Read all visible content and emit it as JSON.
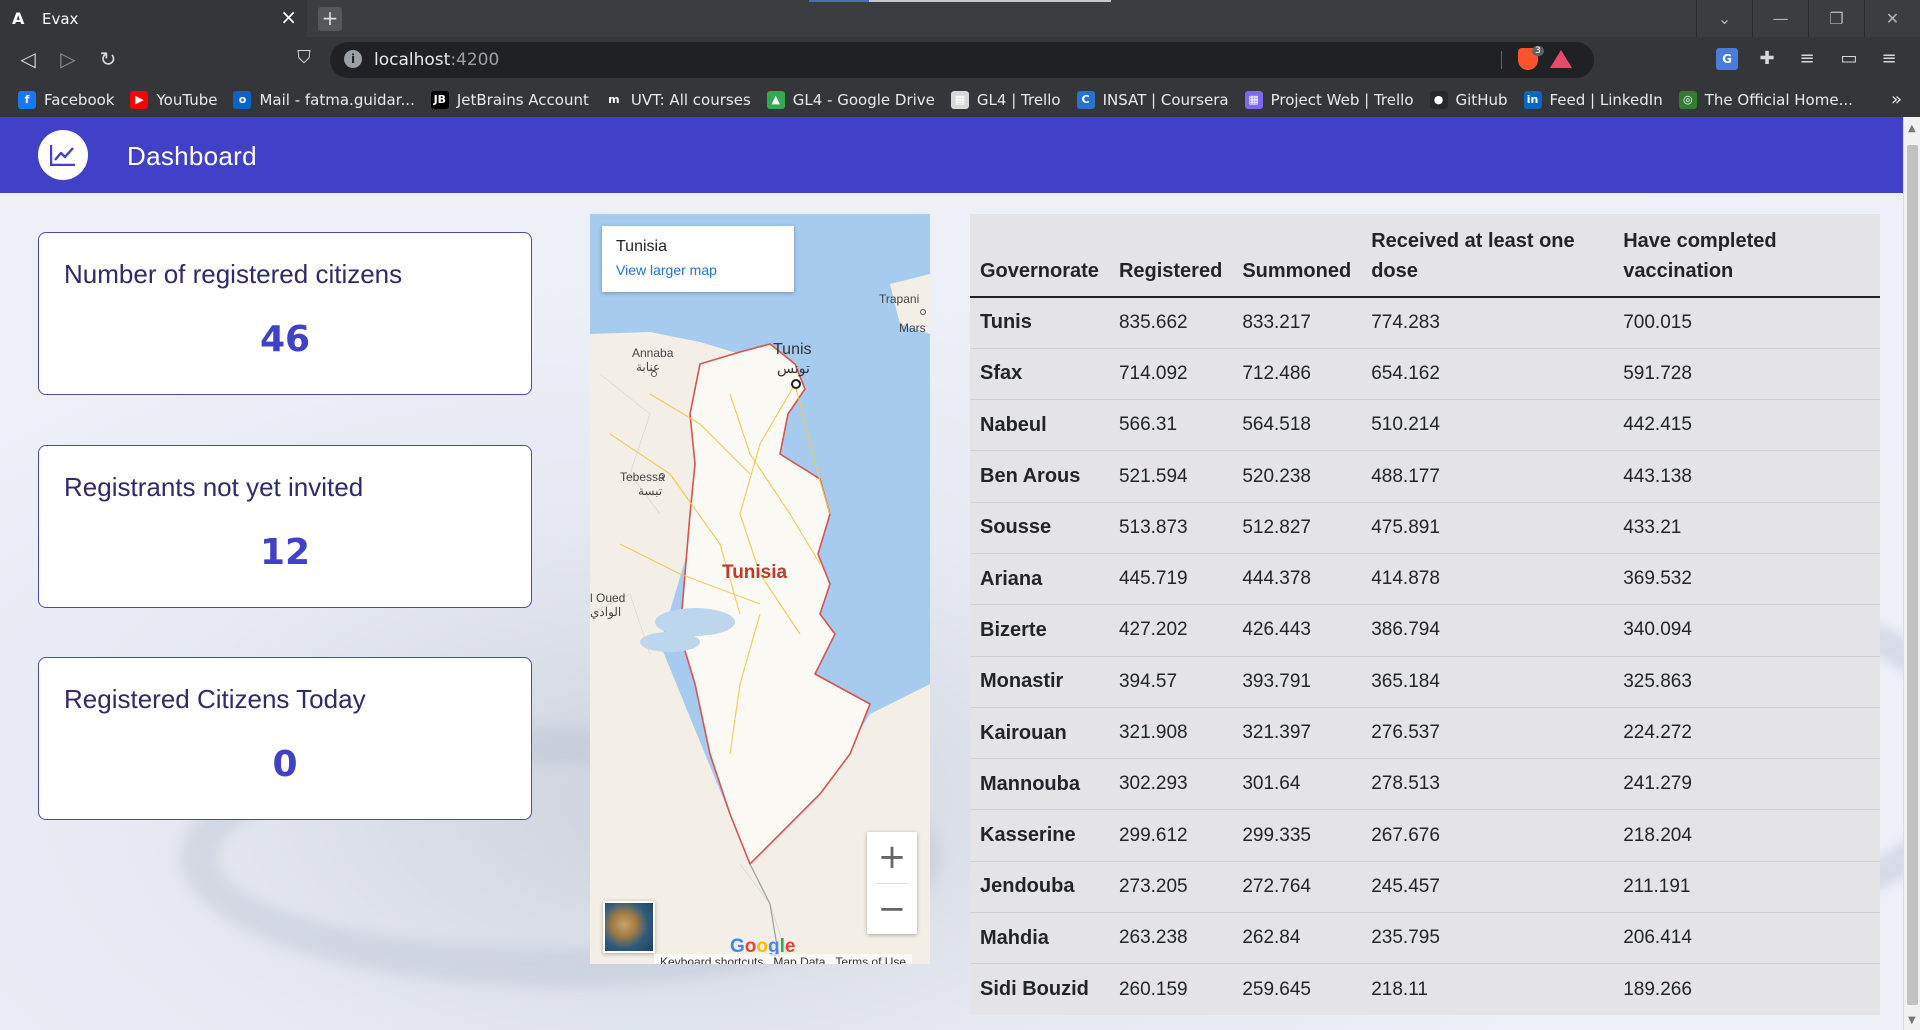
{
  "browser": {
    "tab_title": "Evax",
    "tab_favicon": "A",
    "new_tab": "+",
    "url_host": "localhost",
    "url_port": ":4200",
    "brave_badge": "3",
    "bookmarks": [
      {
        "label": "Facebook",
        "icon": "facebook-icon",
        "color": "#1877f2",
        "glyph": "f"
      },
      {
        "label": "YouTube",
        "icon": "youtube-icon",
        "color": "#ff0000",
        "glyph": "▶"
      },
      {
        "label": "Mail - fatma.guidar...",
        "icon": "outlook-icon",
        "color": "#0a64c8",
        "glyph": "o"
      },
      {
        "label": "JetBrains Account",
        "icon": "jetbrains-icon",
        "color": "#000000",
        "glyph": "JB"
      },
      {
        "label": "UVT: All courses",
        "icon": "moodle-icon",
        "color": "#35363a",
        "glyph": "m"
      },
      {
        "label": "GL4 - Google Drive",
        "icon": "google-drive-icon",
        "color": "#34a853",
        "glyph": "▲"
      },
      {
        "label": "GL4 | Trello",
        "icon": "trello-icon",
        "color": "#d8d8d8",
        "glyph": "▦"
      },
      {
        "label": "INSAT | Coursera",
        "icon": "coursera-icon",
        "color": "#2a73cc",
        "glyph": "C"
      },
      {
        "label": "Project Web | Trello",
        "icon": "trello-icon",
        "color": "#7b68ee",
        "glyph": "▦"
      },
      {
        "label": "GitHub",
        "icon": "github-icon",
        "color": "#24292e",
        "glyph": "●"
      },
      {
        "label": "Feed | LinkedIn",
        "icon": "linkedin-icon",
        "color": "#0a66c2",
        "glyph": "in"
      },
      {
        "label": "The Official Home...",
        "icon": "globe-icon",
        "color": "#2e7d32",
        "glyph": "◎"
      }
    ],
    "bookmarks_more": "»"
  },
  "app": {
    "title": "Dashboard",
    "accent": "#4140c9"
  },
  "stats": [
    {
      "label": "Number of registered citizens",
      "value": "46"
    },
    {
      "label": "Registrants not yet invited",
      "value": "12"
    },
    {
      "label": "Registered Citizens Today",
      "value": "0"
    }
  ],
  "map": {
    "place": "Tunisia",
    "larger_link": "View larger map",
    "country_label": "Tunisia",
    "city_labels": {
      "tunis": "Tunis",
      "tunis_ar": "تونس",
      "annaba": "Annaba",
      "annaba_ar": "عنابة",
      "tebessa": "Tebessa",
      "tebessa_ar": "تبسة",
      "oued": "l Oued",
      "oued_ar": "الوادي",
      "trapani": "Trapani",
      "marsala": "Mars"
    },
    "zoom_in": "+",
    "zoom_out": "−",
    "google": "Google",
    "footer": [
      "Keyboard shortcuts",
      "Map Data",
      "Terms of Use"
    ]
  },
  "table": {
    "headers": [
      "Governorate",
      "Registered",
      "Summoned",
      "Received at least one dose",
      "Have completed vaccination"
    ],
    "rows": [
      [
        "Tunis",
        "835.662",
        "833.217",
        "774.283",
        "700.015"
      ],
      [
        "Sfax",
        "714.092",
        "712.486",
        "654.162",
        "591.728"
      ],
      [
        "Nabeul",
        "566.31",
        "564.518",
        "510.214",
        "442.415"
      ],
      [
        "Ben Arous",
        "521.594",
        "520.238",
        "488.177",
        "443.138"
      ],
      [
        "Sousse",
        "513.873",
        "512.827",
        "475.891",
        "433.21"
      ],
      [
        "Ariana",
        "445.719",
        "444.378",
        "414.878",
        "369.532"
      ],
      [
        "Bizerte",
        "427.202",
        "426.443",
        "386.794",
        "340.094"
      ],
      [
        "Monastir",
        "394.57",
        "393.791",
        "365.184",
        "325.863"
      ],
      [
        "Kairouan",
        "321.908",
        "321.397",
        "276.537",
        "224.272"
      ],
      [
        "Mannouba",
        "302.293",
        "301.64",
        "278.513",
        "241.279"
      ],
      [
        "Kasserine",
        "299.612",
        "299.335",
        "267.676",
        "218.204"
      ],
      [
        "Jendouba",
        "273.205",
        "272.764",
        "245.457",
        "211.191"
      ],
      [
        "Mahdia",
        "263.238",
        "262.84",
        "235.795",
        "206.414"
      ],
      [
        "Sidi Bouzid",
        "260.159",
        "259.645",
        "218.11",
        "189.266"
      ]
    ]
  }
}
